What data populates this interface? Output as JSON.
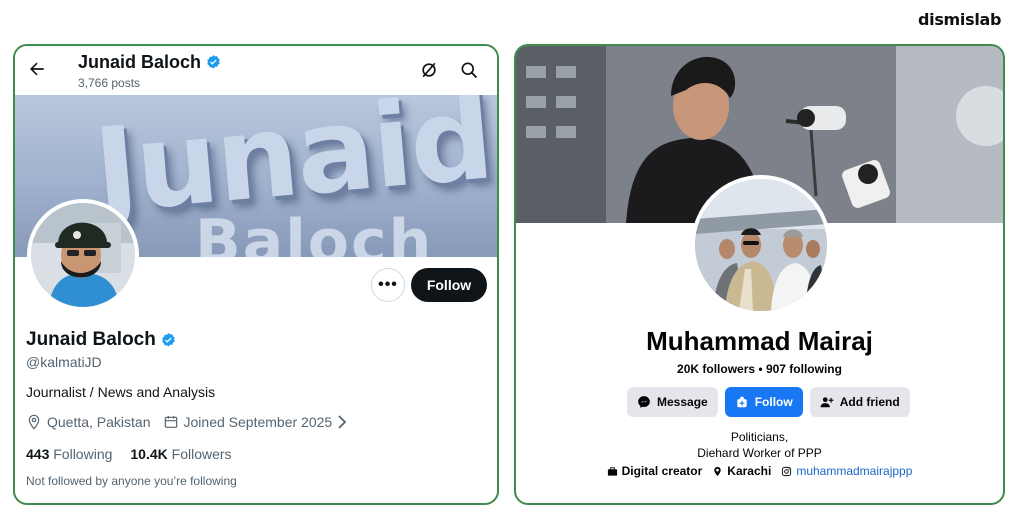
{
  "brand": "dismislab",
  "x_profile": {
    "header_name": "Junaid Baloch",
    "posts": "3,766 posts",
    "banner_text": "Junaid",
    "banner_text2": "Baloch",
    "follow_label": "Follow",
    "more_label": "•••",
    "name": "Junaid Baloch",
    "handle": "@kalmatiJD",
    "bio": "Journalist / News and Analysis",
    "location": "Quetta, Pakistan",
    "joined": "Joined September 2025",
    "following_count": "443",
    "following_label": "Following",
    "followers_count": "10.4K",
    "followers_label": "Followers",
    "not_followed": "Not followed by anyone you’re following",
    "verified_color": "#1d9bf0"
  },
  "fb_profile": {
    "name": "Muhammad Mairaj",
    "stats": "20K followers • 907 following",
    "message_label": "Message",
    "follow_label": "Follow",
    "add_friend_label": "Add friend",
    "bio_line1": "Politicians,",
    "bio_line2": "Diehard Worker of PPP",
    "category": "Digital creator",
    "city": "Karachi",
    "instagram": "muhammadmairajppp",
    "accent": "#1877f2"
  }
}
